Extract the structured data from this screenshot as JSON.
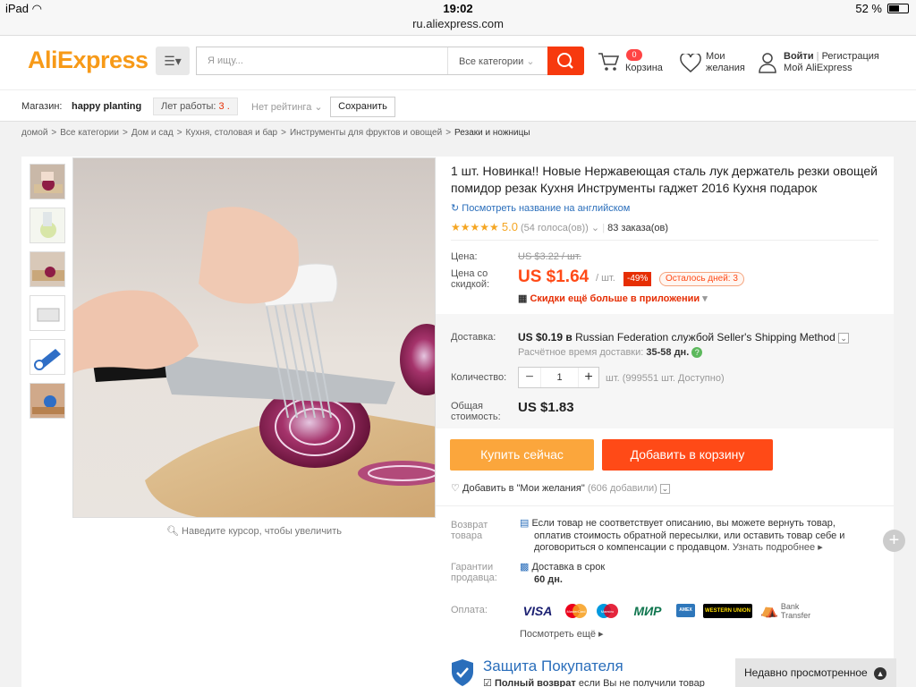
{
  "statusbar": {
    "device": "iPad",
    "time": "19:02",
    "url": "ru.aliexpress.com",
    "battery": "52 %"
  },
  "header": {
    "logo_main": "AliExpress",
    "search_placeholder": "Я ищу...",
    "categories": "Все категории",
    "cart_count": "0",
    "cart_label": "Корзина",
    "wish_line1": "Мои",
    "wish_line2": "желания",
    "login": "Войти",
    "sep": "|",
    "register": "Регистрация",
    "my_ali": "Мой AliExpress"
  },
  "shop": {
    "label": "Магазин:",
    "name": "happy planting",
    "years_label": "Лет работы:",
    "years_value": "3",
    "rating": "Нет рейтинга",
    "save": "Сохранить"
  },
  "breadcrumb": [
    "домой",
    ">",
    "Все категории",
    ">",
    "Дом и сад",
    ">",
    "Кухня, столовая и бар",
    ">",
    "Инструменты для фруктов и овощей",
    ">",
    "Резаки и ножницы"
  ],
  "gallery": {
    "hint": "Наведите курсор, чтобы увеличить"
  },
  "product": {
    "title": "1 шт. Новинка!! Новые Нержавеющая сталь лук держатель резки овощей помидор резак Кухня Инструменты гаджет 2016 Кухня подарок",
    "translate_link": "Посмотреть название на английском",
    "rating": "5.0",
    "votes": "(54 голоса(ов))",
    "orders": "83 заказа(ов)",
    "price_label": "Цена:",
    "old_price": "US $3.22 / шт.",
    "sale_label_1": "Цена со",
    "sale_label_2": "скидкой:",
    "sale_price": "US $1.64",
    "unit": "/ шт.",
    "discount": "-49%",
    "days_left": "Осталось дней: 3",
    "app_discount": "Скидки ещё больше в приложении",
    "shipping_label": "Доставка:",
    "shipping_cost": "US $0.19",
    "shipping_in": "в",
    "shipping_dest": "Russian Federation службой Seller's Shipping Method",
    "delivery_time_label": "Расчётное время доставки:",
    "delivery_time": "35-58 дн.",
    "qty_label": "Количество:",
    "qty_value": "1",
    "qty_available": "шт. (999551 шт. Доступно)",
    "total_label_1": "Общая",
    "total_label_2": "стоимость:",
    "total": "US $1.83",
    "buy_now": "Купить сейчас",
    "add_cart": "Добавить в корзину",
    "wishlist": "Добавить в \"Мои желания\"",
    "wishlist_count": "(606 добавили)"
  },
  "guarantees": {
    "return_label_1": "Возврат",
    "return_label_2": "товара",
    "return_text_1": "Если товар не соответствует описанию, вы можете вернуть товар,",
    "return_text_2": "оплатив стоимость обратной пересылки, или оставить товар себе и",
    "return_text_3": "договориться о компенсации с продавцом.",
    "return_more": "Узнать подробнее",
    "seller_label_1": "Гарантии",
    "seller_label_2": "продавца:",
    "seller_text": "Доставка в срок",
    "seller_days": "60 дн.",
    "payment_label": "Оплата:",
    "payments": [
      "VISA",
      "MasterCard",
      "Maestro",
      "МИР",
      "AMEX",
      "WESTERN UNION",
      "Bank",
      "Transfer"
    ],
    "see_more": "Посмотреть ещё",
    "protection_title": "Защита Покупателя",
    "protection_item_bold": "Полный возврат",
    "protection_item": "если Вы не получили товар"
  },
  "recent": {
    "label": "Недавно просмотренное"
  },
  "colors": {
    "accent": "#ff4a17",
    "buy": "#fba63c",
    "price": "#ff4a17",
    "link": "#2a6ebb",
    "stars": "#f5a623"
  }
}
